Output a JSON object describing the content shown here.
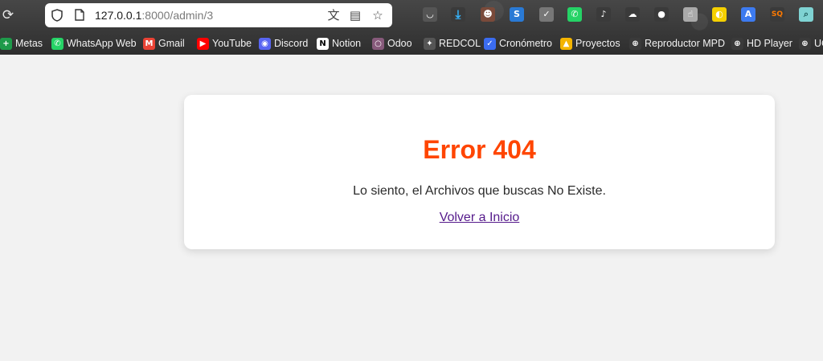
{
  "browser": {
    "url_host": "127.0.0.1",
    "url_rest": ":8000/admin/3",
    "icons": {
      "reload": "reload-icon",
      "shield": "shield-icon",
      "page": "page-icon",
      "translate": "translate-icon",
      "reader": "reader-icon",
      "star": "star-icon"
    }
  },
  "bookmarks": [
    {
      "label": "Metas",
      "icon": "metas-icon",
      "color": "#1e9a4a",
      "glyph": "+"
    },
    {
      "label": "WhatsApp Web",
      "icon": "whatsapp-icon",
      "color": "#25d366",
      "glyph": "✆"
    },
    {
      "label": "Gmail",
      "icon": "gmail-icon",
      "color": "#ea4335",
      "glyph": "M"
    },
    {
      "label": "YouTube",
      "icon": "youtube-icon",
      "color": "#ff0000",
      "glyph": "▶"
    },
    {
      "label": "Discord",
      "icon": "discord-icon",
      "color": "#5865f2",
      "glyph": "◉"
    },
    {
      "label": "Notion",
      "icon": "notion-icon",
      "color": "#ffffff",
      "glyph": "N"
    },
    {
      "label": "Odoo",
      "icon": "odoo-icon",
      "color": "#875a7b",
      "glyph": "○"
    },
    {
      "label": "REDCOL",
      "icon": "redcol-icon",
      "color": "#555555",
      "glyph": "✦"
    },
    {
      "label": "Cronómetro",
      "icon": "cronometro-icon",
      "color": "#3b6cf0",
      "glyph": "✓"
    },
    {
      "label": "Proyectos",
      "icon": "drive-icon",
      "color": "#f4b400",
      "glyph": "▲"
    },
    {
      "label": "Reproductor MPD",
      "icon": "globe-icon",
      "color": "#3a3a3a",
      "glyph": "⊕"
    },
    {
      "label": "HD Player",
      "icon": "globe-icon",
      "color": "#3a3a3a",
      "glyph": "⊕"
    },
    {
      "label": "UC",
      "icon": "globe-icon",
      "color": "#3a3a3a",
      "glyph": "⊕"
    }
  ],
  "extensions": [
    {
      "icon": "pocket-icon",
      "color": "#555555",
      "glyph": "◡"
    },
    {
      "icon": "download-icon",
      "color": "#3a3a3a",
      "glyph": "⤓"
    },
    {
      "icon": "profile-icon",
      "color": "#7a4a3a",
      "glyph": "☻"
    },
    {
      "icon": "s-extension-icon",
      "color": "#2a7ad5",
      "glyph": "S"
    },
    {
      "icon": "adblock-shield-icon",
      "color": "#777777",
      "glyph": "✓"
    },
    {
      "icon": "whatsapp-ext-icon",
      "color": "#25d366",
      "glyph": "✆"
    },
    {
      "icon": "music-note-icon",
      "color": "#3a3a3a",
      "glyph": "♪"
    },
    {
      "icon": "cloud-icon",
      "color": "#3a3a3a",
      "glyph": "☁"
    },
    {
      "icon": "ball-icon",
      "color": "#3a3a3a",
      "glyph": "●"
    },
    {
      "icon": "touch-icon",
      "color": "#aaaaaa",
      "glyph": "☝"
    },
    {
      "icon": "bulb-icon",
      "color": "#f5d000",
      "glyph": "◐"
    },
    {
      "icon": "translate-ext-icon",
      "color": "#3d7bf0",
      "glyph": "A"
    },
    {
      "icon": "sq-icon",
      "color": "#3a3a3a",
      "glyph": "SQ"
    },
    {
      "icon": "search-ext-icon",
      "color": "#7fd3d3",
      "glyph": "⌕"
    }
  ],
  "page": {
    "title": "Error 404",
    "message": "Lo siento, el Archivos que buscas No Existe.",
    "link": "Volver a Inicio",
    "title_color": "#ff4500"
  }
}
